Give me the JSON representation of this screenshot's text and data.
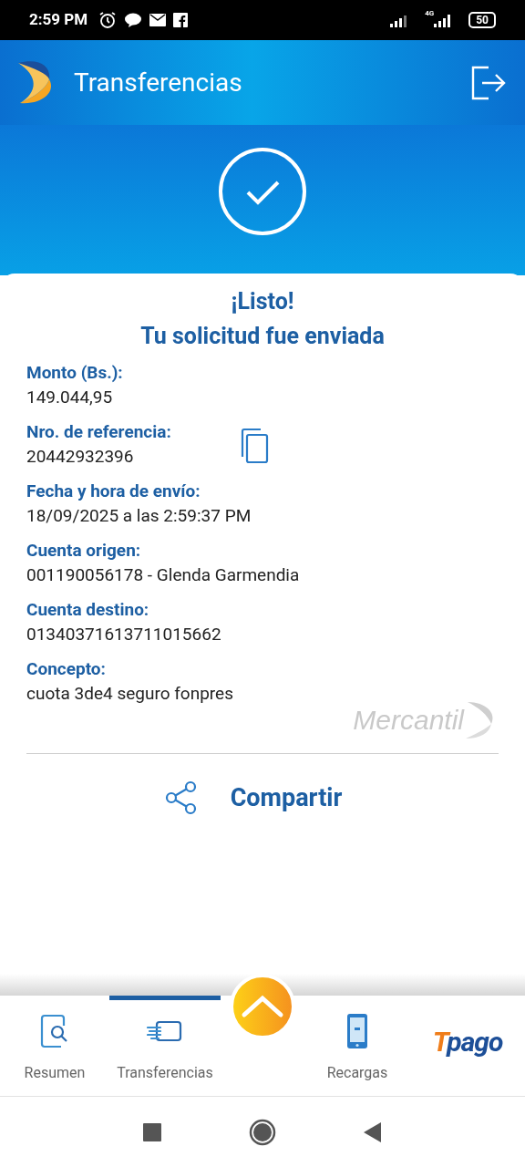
{
  "status_bar": {
    "time": "2:59 PM",
    "network": "4G",
    "battery": "50"
  },
  "app_bar": {
    "title": "Transferencias"
  },
  "result": {
    "title": "¡Listo!",
    "subtitle": "Tu solicitud fue enviada"
  },
  "fields": [
    {
      "label": "Monto (Bs.):",
      "value": "149.044,95",
      "copyable": false
    },
    {
      "label": "Nro. de referencia:",
      "value": "20442932396",
      "copyable": true
    },
    {
      "label": "Fecha y hora de envío:",
      "value": "18/09/2025 a las 2:59:37 PM",
      "copyable": false
    },
    {
      "label": "Cuenta origen:",
      "value": "001190056178 - Glenda Garmendia",
      "copyable": false
    },
    {
      "label": "Cuenta destino:",
      "value": "01340371613711015662",
      "copyable": false
    },
    {
      "label": "Concepto:",
      "value": "cuota 3de4 seguro fonpres",
      "copyable": false
    }
  ],
  "brand_mark": "Mercantil",
  "share": {
    "label": "Compartir"
  },
  "bottom_nav": [
    {
      "kind": "tab",
      "label": "Resumen",
      "selected": false
    },
    {
      "kind": "tab",
      "label": "Transferencias",
      "selected": true
    },
    {
      "kind": "fab"
    },
    {
      "kind": "tab",
      "label": "Recargas",
      "selected": false
    },
    {
      "kind": "logo",
      "first": "T",
      "rest": "pago"
    }
  ]
}
